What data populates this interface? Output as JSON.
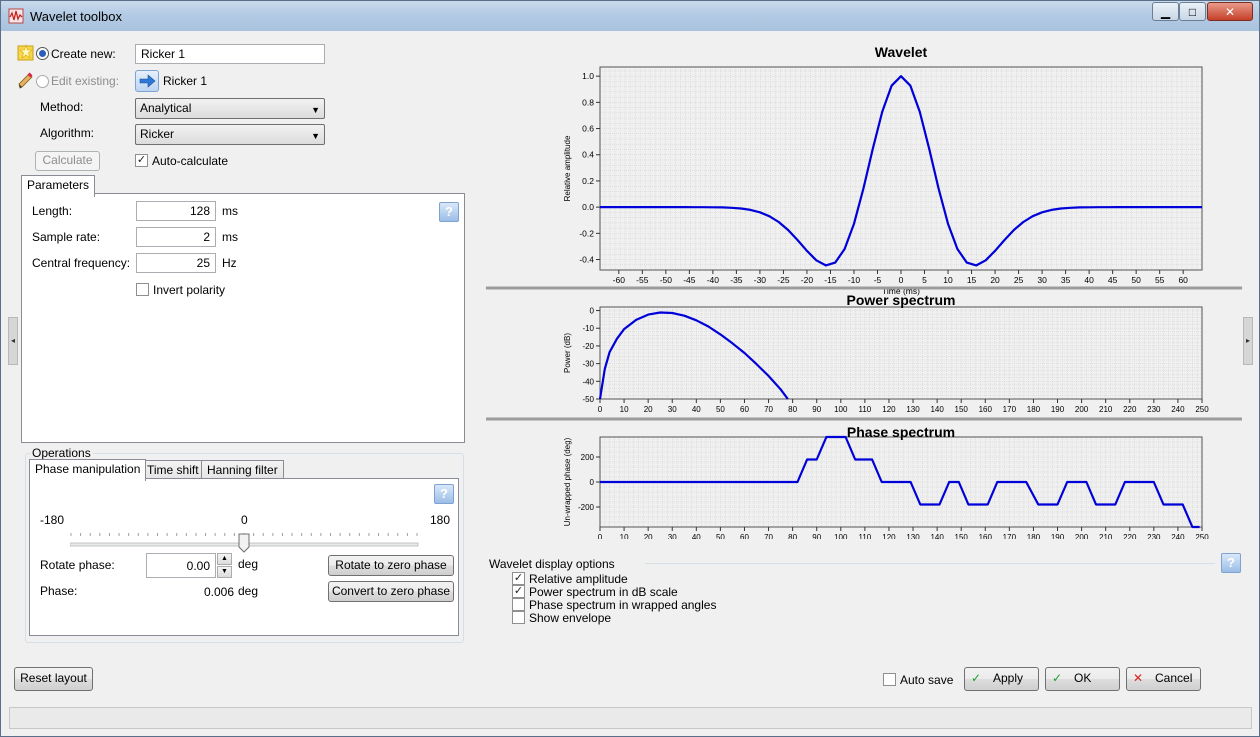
{
  "window": {
    "title": "Wavelet toolbox",
    "minimize_glyph": "▁",
    "maximize_glyph": "□",
    "close_glyph": "✕"
  },
  "create": {
    "label": "Create new:",
    "value": "Ricker 1"
  },
  "edit": {
    "label": "Edit existing:",
    "value": "Ricker 1"
  },
  "method": {
    "label": "Method:",
    "value": "Analytical"
  },
  "algorithm": {
    "label": "Algorithm:",
    "value": "Ricker"
  },
  "calculate_label": "Calculate",
  "auto_calculate": {
    "label": "Auto-calculate",
    "checked": true
  },
  "parameters": {
    "tab_label": "Parameters",
    "length": {
      "label": "Length:",
      "value": "128",
      "unit": "ms"
    },
    "sample_rate": {
      "label": "Sample rate:",
      "value": "2",
      "unit": "ms"
    },
    "central_frequency": {
      "label": "Central frequency:",
      "value": "25",
      "unit": "Hz"
    },
    "invert_polarity": {
      "label": "Invert polarity",
      "checked": false
    }
  },
  "operations": {
    "label": "Operations",
    "tabs": [
      "Phase manipulation",
      "Time shift",
      "Hanning filter"
    ],
    "slider": {
      "min_label": "-180",
      "mid_label": "0",
      "max_label": "180",
      "value": 0
    },
    "rotate_phase": {
      "label": "Rotate phase:",
      "value": "0.00",
      "unit": "deg"
    },
    "phase": {
      "label": "Phase:",
      "value": "0.006",
      "unit": "deg"
    },
    "rotate_zero_label": "Rotate to zero phase",
    "convert_zero_label": "Convert to zero phase"
  },
  "help_glyph": "?",
  "reset_layout_label": "Reset layout",
  "display_options": {
    "label": "Wavelet display options",
    "items": [
      {
        "label": "Relative amplitude",
        "checked": true
      },
      {
        "label": "Power spectrum in dB scale",
        "checked": true
      },
      {
        "label": "Phase spectrum in wrapped angles",
        "checked": false
      },
      {
        "label": "Show envelope",
        "checked": false
      }
    ]
  },
  "footer": {
    "auto_save": {
      "label": "Auto save",
      "checked": false
    },
    "apply_label": "Apply",
    "ok_label": "OK",
    "cancel_label": "Cancel"
  },
  "colors": {
    "series": "#0000d8",
    "grid": "#d0d0d0",
    "accent": "#2b5db8"
  },
  "chart_data": [
    {
      "type": "line",
      "title": "Wavelet",
      "xlabel": "Time (ms)",
      "ylabel": "Relative amplitude",
      "xlim": [
        -64,
        64
      ],
      "ylim": [
        -0.48,
        1.07
      ],
      "xticks": [
        -60,
        -55,
        -50,
        -45,
        -40,
        -35,
        -30,
        -25,
        -20,
        -15,
        -10,
        -5,
        0,
        5,
        10,
        15,
        20,
        25,
        30,
        35,
        40,
        45,
        50,
        55,
        60
      ],
      "yticks": [
        -0.4,
        -0.2,
        0.0,
        0.2,
        0.4,
        0.6,
        0.8,
        1.0
      ],
      "ytick_labels": [
        "-0.4",
        "-0.2",
        "0.0",
        "0.2",
        "0.4",
        "0.6",
        "0.8",
        "1.0"
      ],
      "grid": true,
      "series": [
        {
          "ricker_frequency_hz": 25,
          "sample_ms": 2,
          "length_ms": 128
        }
      ]
    },
    {
      "type": "line",
      "title": "Power spectrum",
      "xlabel": "",
      "ylabel": "Power (dB)",
      "xlim": [
        0,
        250
      ],
      "ylim": [
        -50,
        2
      ],
      "xticks": [
        0,
        10,
        20,
        30,
        40,
        50,
        60,
        70,
        80,
        90,
        100,
        110,
        120,
        130,
        140,
        150,
        160,
        170,
        180,
        190,
        200,
        210,
        220,
        230,
        240,
        250
      ],
      "yticks": [
        0,
        -10,
        -20,
        -30,
        -40,
        -50
      ],
      "grid": true,
      "series": [
        {
          "x": [
            0,
            2,
            4,
            7,
            10,
            15,
            20,
            25,
            30,
            35,
            40,
            45,
            50,
            55,
            60,
            65,
            70,
            75,
            78
          ],
          "y": [
            -50,
            -33,
            -23.5,
            -16,
            -10.5,
            -5.3,
            -2.3,
            -1.1,
            -1.4,
            -2.9,
            -5.5,
            -9.0,
            -13.5,
            -18.5,
            -24.0,
            -30.3,
            -37.0,
            -44.5,
            -50
          ]
        }
      ]
    },
    {
      "type": "line",
      "title": "Phase spectrum",
      "xlabel": "",
      "ylabel": "Un-wrapped phase (deg)",
      "xlim": [
        0,
        250
      ],
      "ylim": [
        -360,
        360
      ],
      "xticks": [
        0,
        10,
        20,
        30,
        40,
        50,
        60,
        70,
        80,
        90,
        100,
        110,
        120,
        130,
        140,
        150,
        160,
        170,
        180,
        190,
        200,
        210,
        220,
        230,
        240,
        250
      ],
      "yticks": [
        200,
        0,
        -200
      ],
      "grid": true,
      "series": [
        {
          "x": [
            0,
            82,
            86,
            90,
            94,
            98,
            102,
            106,
            110,
            113,
            117,
            129,
            133,
            137,
            141,
            145,
            149,
            153,
            157,
            161,
            165,
            168,
            172,
            177,
            182,
            186,
            190,
            194,
            198,
            202,
            206,
            210,
            214,
            218,
            222,
            226,
            230,
            234,
            238,
            242,
            246,
            249
          ],
          "y": [
            0,
            0,
            180,
            180,
            360,
            360,
            360,
            180,
            180,
            180,
            0,
            0,
            -180,
            -180,
            -180,
            0,
            0,
            -180,
            -180,
            -180,
            0,
            0,
            0,
            0,
            -180,
            -180,
            -180,
            0,
            0,
            0,
            -180,
            -180,
            -180,
            0,
            0,
            0,
            0,
            -180,
            -180,
            -180,
            -360,
            -360
          ]
        }
      ]
    }
  ]
}
